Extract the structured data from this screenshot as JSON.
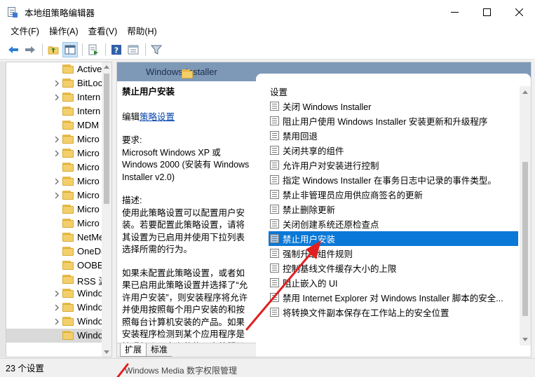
{
  "window": {
    "title": "本地组策略编辑器"
  },
  "menu": {
    "items": [
      "文件(F)",
      "操作(A)",
      "查看(V)",
      "帮助(H)"
    ]
  },
  "toolbar": {
    "icons": [
      "back-arrow-icon",
      "forward-arrow-icon",
      "folder-up-icon",
      "show-hide-tree-icon",
      "export-list-icon",
      "help-icon",
      "properties-icon",
      "filter-icon"
    ]
  },
  "tree": {
    "items": [
      {
        "label": "Active",
        "has_children": false
      },
      {
        "label": "BitLoc",
        "has_children": true
      },
      {
        "label": "Intern",
        "has_children": true
      },
      {
        "label": "Intern",
        "has_children": false
      },
      {
        "label": "MDM",
        "has_children": false
      },
      {
        "label": "Micro",
        "has_children": true
      },
      {
        "label": "Micro",
        "has_children": true
      },
      {
        "label": "Micro",
        "has_children": false
      },
      {
        "label": "Micro",
        "has_children": true
      },
      {
        "label": "Micro",
        "has_children": true
      },
      {
        "label": "Micro",
        "has_children": false
      },
      {
        "label": "Micro",
        "has_children": false
      },
      {
        "label": "NetMe",
        "has_children": false
      },
      {
        "label": "OneDr",
        "has_children": false
      },
      {
        "label": "OOBE",
        "has_children": false
      },
      {
        "label": "RSS 源",
        "has_children": false
      },
      {
        "label": "Windo",
        "has_children": true
      },
      {
        "label": "Windo",
        "has_children": true
      },
      {
        "label": "Windo",
        "has_children": true
      },
      {
        "label": "Windo",
        "has_children": false,
        "selected": true
      }
    ]
  },
  "header": {
    "title": "Windows Installer"
  },
  "description": {
    "title": "禁止用户安装",
    "edit_prefix": "编辑",
    "edit_link": "策略设置",
    "requirements": "要求:\nMicrosoft Windows XP 或 Windows 2000 (安装有 Windows Installer v2.0)",
    "desc": "描述:\n使用此策略设置可以配置用户安装。若要配置此策略设置，请将其设置为已启用并使用下拉列表选择所需的行为。",
    "desc2": "如果未配置此策略设置，或者如果已启用此策略设置并选择了“允许用户安装”，则安装程序将允许并使用按照每个用户安装的和按照每台计算机安装的产品。如果安装程序检测到某个应用程序是按照每个用户安装的，它将服从这个按照每台"
  },
  "list": {
    "column": "设置",
    "items": [
      "关闭 Windows Installer",
      "阻止用户使用 Windows Installer 安装更新和升级程序",
      "禁用回退",
      "关闭共享的组件",
      "允许用户对安装进行控制",
      "指定 Windows Installer 在事务日志中记录的事件类型。",
      "禁止非管理员应用供应商签名的更新",
      "禁止删除更新",
      "关闭创建系统还原检查点",
      "禁止用户安装",
      "强制升级组件规则",
      "控制基线文件缓存大小的上限",
      "阻止嵌入的 UI",
      "禁用 Internet Explorer 对 Windows Installer 脚本的安全...",
      "将转换文件副本保存在工作站上的安全位置"
    ],
    "selected_index": 9
  },
  "tabs": {
    "extended": "扩展",
    "standard": "标准"
  },
  "status": {
    "text": "23 个设置"
  },
  "background": {
    "behind_text": "Windows Media 数字权限管理"
  },
  "colors": {
    "selection": "#0a78d6",
    "header": "#7e98b8",
    "annotation_arrow": "#e02020"
  }
}
